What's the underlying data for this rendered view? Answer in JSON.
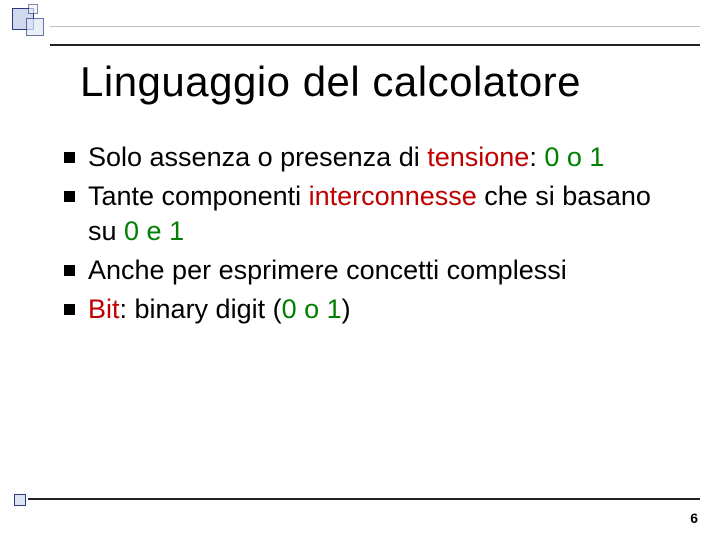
{
  "slide": {
    "title": "Linguaggio del calcolatore",
    "bullets": [
      {
        "pre": "Solo assenza o presenza di ",
        "em": "tensione",
        "post": ": ",
        "tail": "0 o 1",
        "emClass": "red",
        "tailClass": "green"
      },
      {
        "pre": "Tante componenti ",
        "em": "interconnesse",
        "post": " che si basano su ",
        "tail": "0 e 1",
        "emClass": "red",
        "tailClass": "green"
      },
      {
        "pre": "Anche per esprimere concetti complessi",
        "em": "",
        "post": "",
        "tail": "",
        "emClass": "",
        "tailClass": ""
      },
      {
        "pre": "",
        "em": "Bit",
        "post": ": binary digit (",
        "tail": "0 o 1",
        "emClass": "red",
        "tailClass": "green",
        "close": ")"
      }
    ],
    "page_number": "6"
  }
}
